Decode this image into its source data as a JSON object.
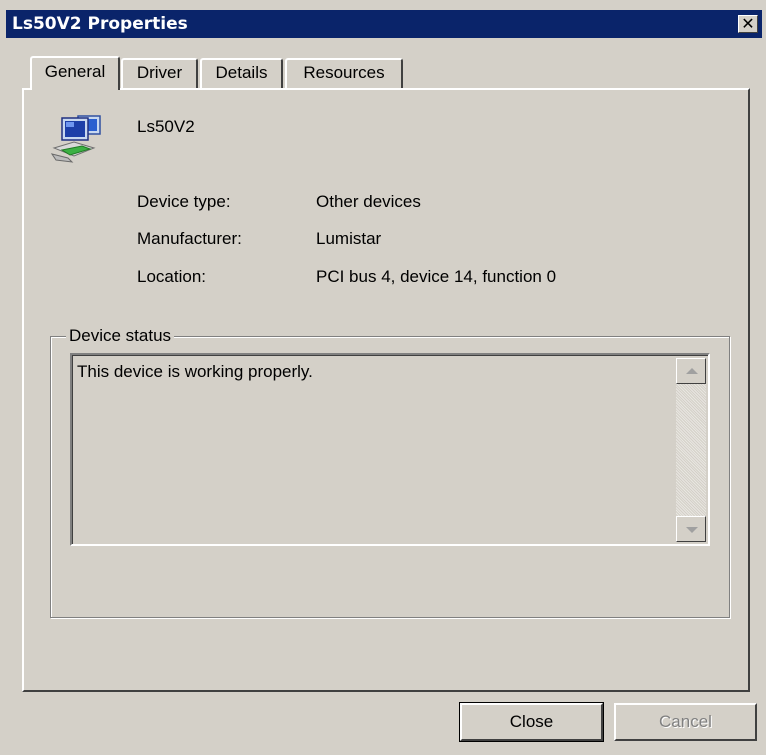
{
  "window": {
    "title": "Ls50V2 Properties",
    "close_glyph": "✕"
  },
  "tabs": [
    {
      "label": "General",
      "active": true
    },
    {
      "label": "Driver",
      "active": false
    },
    {
      "label": "Details",
      "active": false
    },
    {
      "label": "Resources",
      "active": false
    }
  ],
  "device": {
    "icon": "network-adapter-icon",
    "name": "Ls50V2"
  },
  "properties": [
    {
      "label": "Device type:",
      "value": "Other devices"
    },
    {
      "label": "Manufacturer:",
      "value": "Lumistar"
    },
    {
      "label": "Location:",
      "value": "PCI bus 4, device 14, function 0"
    }
  ],
  "device_status": {
    "legend": "Device status",
    "text": "This device is working properly."
  },
  "buttons": {
    "close": "Close",
    "cancel": "Cancel"
  },
  "colors": {
    "titlebar": "#0a246a",
    "face": "#d4d0c8"
  }
}
